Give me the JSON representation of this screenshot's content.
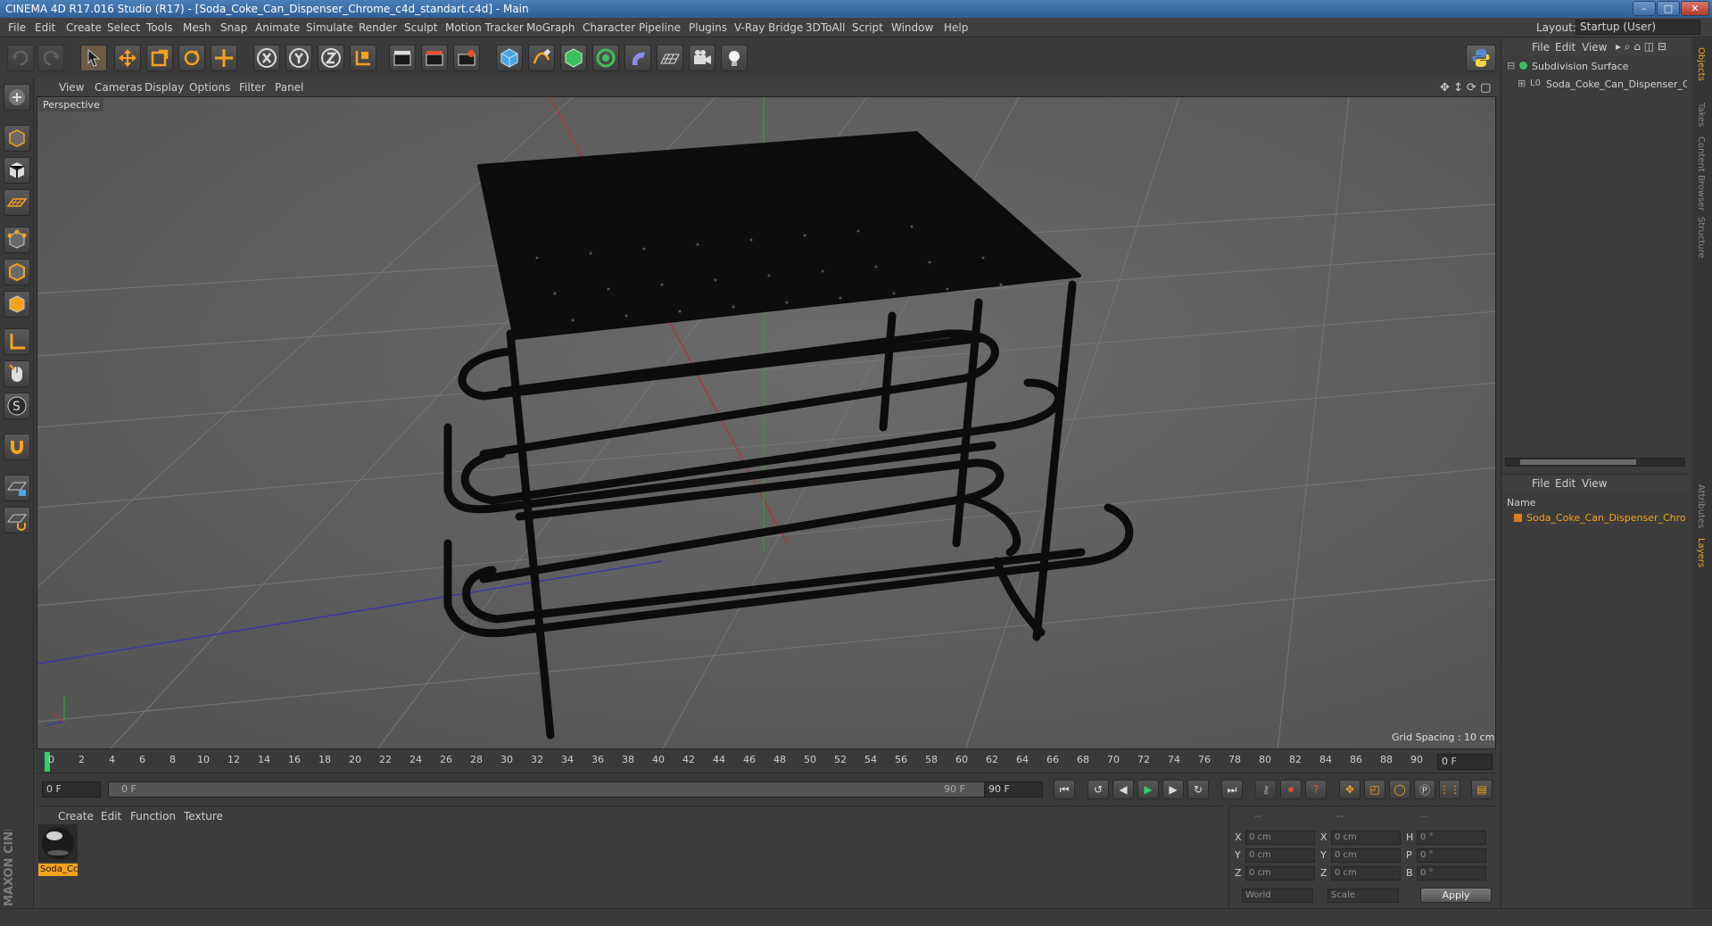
{
  "window": {
    "title": "CINEMA 4D R17.016 Studio (R17) - [Soda_Coke_Can_Dispenser_Chrome_c4d_standart.c4d] - Main",
    "layout_label": "Layout:",
    "layout_value": "Startup (User)"
  },
  "menu": [
    "File",
    "Edit",
    "Create",
    "Select",
    "Tools",
    "Mesh",
    "Snap",
    "Animate",
    "Simulate",
    "Render",
    "Sculpt",
    "Motion Tracker",
    "MoGraph",
    "Character",
    "Pipeline",
    "Plugins",
    "V-Ray Bridge",
    "3DToAll",
    "Script",
    "Window",
    "Help"
  ],
  "viewport": {
    "menu": [
      "View",
      "Cameras",
      "Display",
      "Options",
      "Filter",
      "Panel"
    ],
    "label": "Perspective",
    "grid_spacing": "Grid Spacing : 10 cm"
  },
  "timeline": {
    "ticks": [
      "0",
      "2",
      "4",
      "6",
      "8",
      "10",
      "12",
      "14",
      "16",
      "18",
      "20",
      "22",
      "24",
      "26",
      "28",
      "30",
      "32",
      "34",
      "36",
      "38",
      "40",
      "42",
      "44",
      "46",
      "48",
      "50",
      "52",
      "54",
      "56",
      "58",
      "60",
      "62",
      "64",
      "66",
      "68",
      "70",
      "72",
      "74",
      "76",
      "78",
      "80",
      "82",
      "84",
      "86",
      "88",
      "90"
    ],
    "current_frame": "0 F",
    "start": "0 F",
    "range_start": "0 F",
    "range_end": "90 F",
    "end": "90 F"
  },
  "materials": {
    "menu": [
      "Create",
      "Edit",
      "Function",
      "Texture"
    ],
    "items": [
      {
        "name": "Soda_Cc"
      }
    ]
  },
  "coords": {
    "header": [
      "--",
      "--",
      "--"
    ],
    "rows": [
      {
        "a": "X",
        "av": "0 cm",
        "b": "X",
        "bv": "0 cm",
        "c": "H",
        "cv": "0 °"
      },
      {
        "a": "Y",
        "av": "0 cm",
        "b": "Y",
        "bv": "0 cm",
        "c": "P",
        "cv": "0 °"
      },
      {
        "a": "Z",
        "av": "0 cm",
        "b": "Z",
        "bv": "0 cm",
        "c": "B",
        "cv": "0 °"
      }
    ],
    "world": "World",
    "scale": "Scale",
    "apply": "Apply"
  },
  "objects": {
    "menu": [
      "File",
      "Edit",
      "View"
    ],
    "items": [
      "Subdivision Surface",
      "Soda_Coke_Can_Dispenser_Chro"
    ]
  },
  "layers": {
    "menu": [
      "File",
      "Edit",
      "View"
    ],
    "col_name": "Name",
    "items": [
      "Soda_Coke_Can_Dispenser_Chron"
    ]
  },
  "side_tabs": [
    "Objects",
    "Takes",
    "Content Browser",
    "Structure",
    "Attributes",
    "Layers"
  ],
  "brand": {
    "text": "MAXON CINEMA 4D"
  },
  "colors": {
    "accent": "#f7a21b",
    "selected": "#e8a03a",
    "layer_orange": "#e07a1f"
  }
}
